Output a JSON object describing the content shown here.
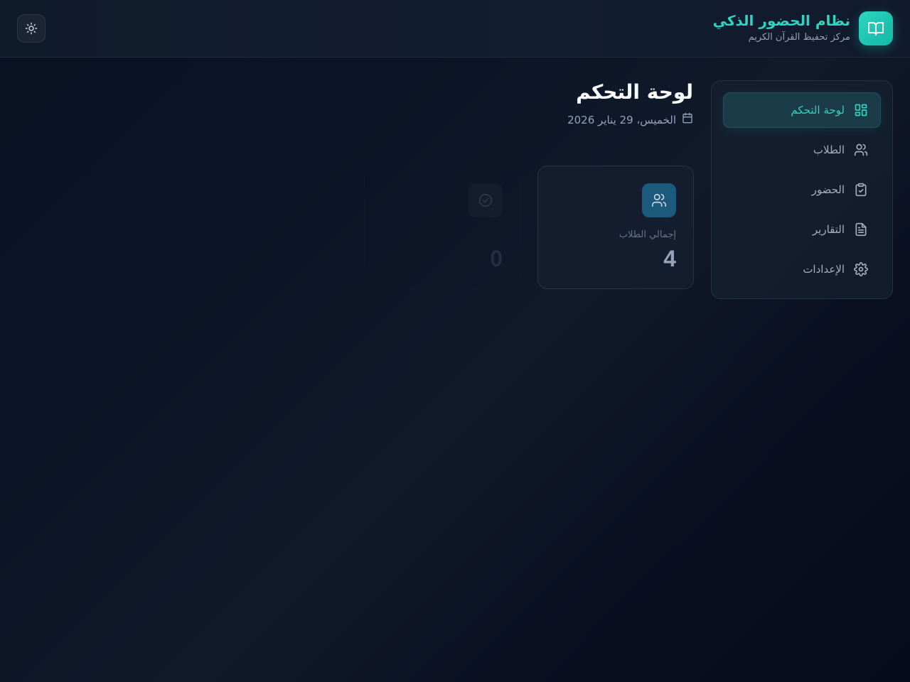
{
  "header": {
    "title": "نظام الحضور الذكي",
    "subtitle": "مركز تحفيظ القرآن الكريم",
    "logo_icon": "book-open-icon",
    "theme_toggle_icon": "sun-icon"
  },
  "sidebar": {
    "items": [
      {
        "label": "لوحة التحكم",
        "icon": "dashboard-grid-icon",
        "active": true
      },
      {
        "label": "الطلاب",
        "icon": "users-icon",
        "active": false
      },
      {
        "label": "الحضور",
        "icon": "clipboard-check-icon",
        "active": false
      },
      {
        "label": "التقارير",
        "icon": "file-text-icon",
        "active": false
      },
      {
        "label": "الإعدادات",
        "icon": "settings-gear-icon",
        "active": false
      }
    ]
  },
  "main": {
    "title": "لوحة التحكم",
    "date": "الخميس، 29 يناير 2026",
    "stats": [
      {
        "label": "إجمالي الطلاب",
        "value": "4",
        "icon": "users-icon"
      },
      {
        "label": "",
        "value": "0",
        "icon": "check-circle-icon"
      }
    ]
  },
  "colors": {
    "accent": "#2dd4bf",
    "background": "#0b1426",
    "active_nav_bg": "#1a3b47",
    "stat_icon_bg": "#1c5a7c"
  }
}
